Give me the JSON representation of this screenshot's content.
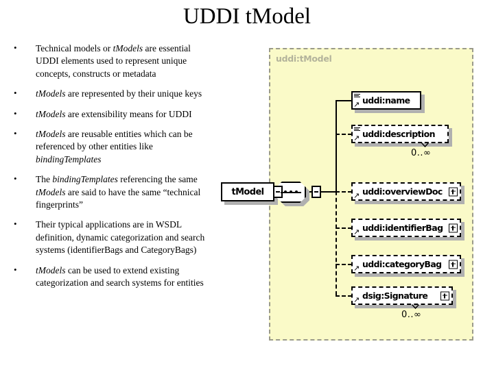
{
  "slide": {
    "title": "UDDI tModel"
  },
  "bullets": [
    {
      "marker": "•",
      "segments": [
        {
          "text": "Technical models or ",
          "italic": false
        },
        {
          "text": "tModels",
          "italic": true
        },
        {
          "text": " are essential UDDI elements used to represent unique concepts, constructs or metadata",
          "italic": false
        }
      ]
    },
    {
      "marker": "•",
      "segments": [
        {
          "text": "tModels",
          "italic": true
        },
        {
          "text": " are represented by their unique keys",
          "italic": false
        }
      ]
    },
    {
      "marker": "•",
      "segments": [
        {
          "text": "tModels",
          "italic": true
        },
        {
          "text": " are extensibility means for UDDI",
          "italic": false
        }
      ]
    },
    {
      "marker": "•",
      "segments": [
        {
          "text": "tModels",
          "italic": true
        },
        {
          "text": " are reusable entities which can be referenced by other entities like ",
          "italic": false
        },
        {
          "text": "bindingTemplates",
          "italic": true
        }
      ]
    },
    {
      "marker": "•",
      "segments": [
        {
          "text": "The ",
          "italic": false
        },
        {
          "text": "bindingTemplates",
          "italic": true
        },
        {
          "text": " referencing the same ",
          "italic": false
        },
        {
          "text": "tModels",
          "italic": true
        },
        {
          "text": " are said to have the same “technical fingerprints”",
          "italic": false
        }
      ]
    },
    {
      "marker": "•",
      "segments": [
        {
          "text": "Their typical applications are in WSDL definition, dynamic categorization and search systems (identifierBags and CategoryBags)",
          "italic": false
        }
      ]
    },
    {
      "marker": "•",
      "segments": [
        {
          "text": "tModels",
          "italic": true
        },
        {
          "text": " can be used to extend existing categorization and search systems for entities",
          "italic": false
        }
      ]
    }
  ],
  "diagram": {
    "panel_label": "uddi:tModel",
    "root_node": "tModel",
    "sequence_connector": "sequence-compositor",
    "colors": {
      "panel_background": "#FAFAC8",
      "panel_border": "#9A9A8A",
      "node_background": "#FFFFFF",
      "node_border": "#000000",
      "node_shadow": "#B0B0B0",
      "panel_label_text": "#B3B39B"
    },
    "nodes": [
      {
        "label": "uddi:name",
        "border": "solid",
        "required": true,
        "expander": false,
        "multiplicity": ""
      },
      {
        "label": "uddi:description",
        "border": "dashed",
        "required": false,
        "expander": false,
        "multiplicity": "0..∞"
      },
      {
        "label": "uddi:overviewDoc",
        "border": "dashed",
        "required": false,
        "expander": true,
        "multiplicity": ""
      },
      {
        "label": "uddi:identifierBag",
        "border": "dashed",
        "required": false,
        "expander": true,
        "multiplicity": ""
      },
      {
        "label": "uddi:categoryBag",
        "border": "dashed",
        "required": false,
        "expander": true,
        "multiplicity": ""
      },
      {
        "label": "dsig:Signature",
        "border": "dashed",
        "required": false,
        "expander": true,
        "multiplicity": "0..∞"
      }
    ]
  }
}
